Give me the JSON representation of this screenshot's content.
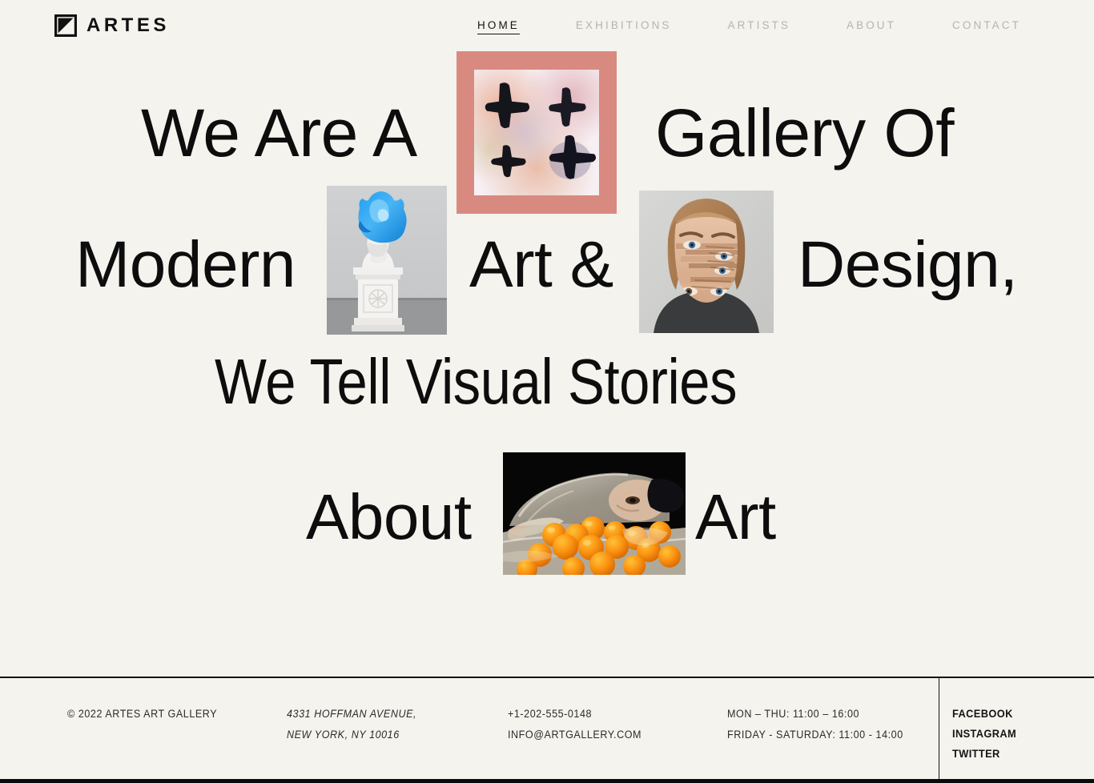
{
  "theme": {
    "background": "#f5f3ee",
    "text": "#0d0d0d",
    "nav_inactive": "#b9b2ac",
    "frame_accent": "#d98a80",
    "rule": "#141414"
  },
  "header": {
    "brand": {
      "mark_icon": "square-diagonal-logo-icon",
      "word": "ARTES"
    },
    "nav": [
      {
        "label": "HOME",
        "active": true
      },
      {
        "label": "EXHIBITIONS",
        "active": false
      },
      {
        "label": "ARTISTS",
        "active": false
      },
      {
        "label": "ABOUT",
        "active": false
      },
      {
        "label": "CONTACT",
        "active": false
      }
    ]
  },
  "hero": {
    "headline_words": {
      "we_are_a": "We Are A",
      "gallery_of": "Gallery Of",
      "modern": "Modern",
      "art_amp": "Art &",
      "design": "Design,",
      "stories": "We Tell Visual Stories",
      "about": "About",
      "art": "Art"
    },
    "images": [
      {
        "name": "abstract-crosses-painting",
        "description": "Framed abstract painting of four black brush crosses on mottled white and pink ground",
        "frame_color": "#d98a80"
      },
      {
        "name": "blue-head-bust-sculpture",
        "description": "White classical plaster bust with blue melted form over the head, on a white carved pedestal"
      },
      {
        "name": "glitch-portrait",
        "description": "Surreal portrait of a woman with a blonde bob, her face smeared into repeated eyes"
      },
      {
        "name": "oranges-plastic-wrap-photo",
        "description": "Person wrapped in clear plastic lying among bright oranges against a black background"
      }
    ]
  },
  "footer": {
    "copyright": "© 2022 ARTES ART GALLERY",
    "address": {
      "line1": "4331 HOFFMAN AVENUE,",
      "line2": "NEW YORK, NY 10016"
    },
    "contact": {
      "phone": "+1-202-555-0148",
      "email": "INFO@ARTGALLERY.COM"
    },
    "hours": {
      "line1": "MON – THU: 11:00 – 16:00",
      "line2": "FRIDAY - SATURDAY: 11:00 - 14:00"
    },
    "social": [
      {
        "label": "FACEBOOK"
      },
      {
        "label": "INSTAGRAM"
      },
      {
        "label": "TWITTER"
      }
    ]
  }
}
